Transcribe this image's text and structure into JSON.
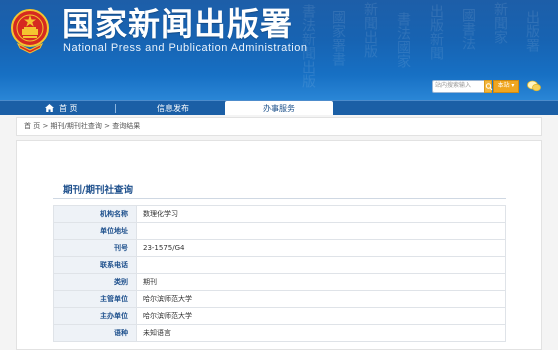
{
  "header": {
    "title_cn": "国家新闻出版署",
    "title_en": "National Press and Publication Administration",
    "search_placeholder": "站内搜索输入",
    "region_label": "本站 ▾",
    "brand_blue": "#1763b2",
    "accent_orange": "#f0a620"
  },
  "nav": {
    "home_label": "首 页",
    "info_label": "信息发布",
    "service_label": "办事服务"
  },
  "breadcrumb": {
    "text": "首 页 > 期刊/期刊社查询 > 查询结果"
  },
  "section": {
    "title": "期刊/期刊社查询"
  },
  "rows": [
    {
      "label": "机构名称",
      "value": "数理化学习"
    },
    {
      "label": "单位地址",
      "value": ""
    },
    {
      "label": "刊号",
      "value": "23-1575/G4"
    },
    {
      "label": "联系电话",
      "value": ""
    },
    {
      "label": "类别",
      "value": "期刊"
    },
    {
      "label": "主管单位",
      "value": "哈尔滨师范大学"
    },
    {
      "label": "主办单位",
      "value": "哈尔滨师范大学"
    },
    {
      "label": "语种",
      "value": "未知语言"
    }
  ]
}
